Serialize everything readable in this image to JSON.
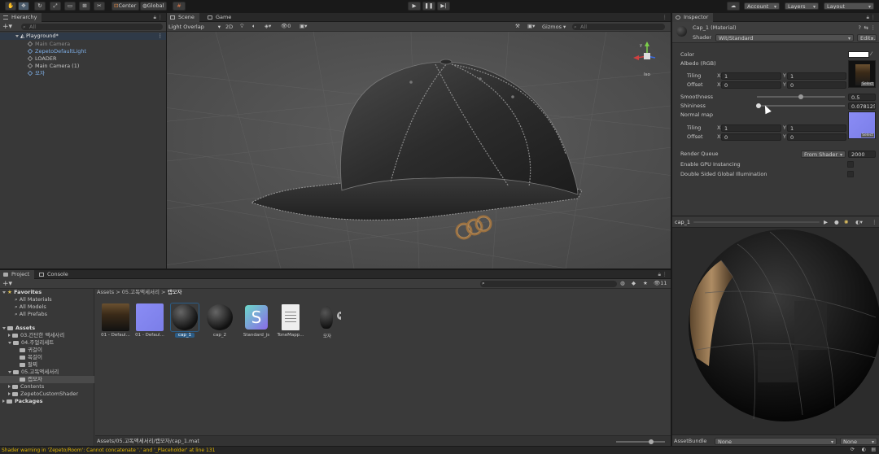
{
  "toolbar": {
    "pivot_label": "Center",
    "space_label": "Global",
    "account_label": "Account",
    "layers_label": "Layers",
    "layout_label": "Layout"
  },
  "hierarchy": {
    "tab_label": "Hierarchy",
    "search_placeholder": "All",
    "scene_name": "Playground*",
    "items": [
      {
        "label": "Main Camera",
        "dim": true
      },
      {
        "label": "ZepetoDefaultLight",
        "blue": true
      },
      {
        "label": "LOADER"
      },
      {
        "label": "Main Camera (1)"
      },
      {
        "label": "모자",
        "blue": true
      }
    ]
  },
  "scene": {
    "tab_scene": "Scene",
    "tab_game": "Game",
    "overlay_label": "Light Overlap",
    "mode_2d": "2D",
    "fx_count": "0",
    "gizmos_label": "Gizmos",
    "search_placeholder": "All",
    "persp_label": "Iso"
  },
  "inspector": {
    "tab_label": "Inspector",
    "material_name": "Cap_1 (Material)",
    "shader_label": "Shader",
    "shader_value": "Wit/Standard",
    "edit_label": "Edit...",
    "color_label": "Color",
    "albedo_label": "Albedo (RGB)",
    "tiling_label": "Tiling",
    "offset_label": "Offset",
    "albedo_tiling": {
      "x": "1",
      "y": "1"
    },
    "albedo_offset": {
      "x": "0",
      "y": "0"
    },
    "smoothness_label": "Smoothness",
    "smoothness_value": "0.5",
    "smoothness_level": 0.5,
    "shininess_label": "Shininess",
    "shininess_value": "0.078125",
    "shininess_level": 0.02,
    "normal_label": "Normal map",
    "normal_tiling": {
      "x": "1",
      "y": "1"
    },
    "normal_offset": {
      "x": "0",
      "y": "0"
    },
    "select_label": "Select",
    "render_queue_label": "Render Queue",
    "render_queue_mode": "From Shader",
    "render_queue_value": "2000",
    "gpu_instancing_label": "Enable GPU Instancing",
    "double_sided_label": "Double Sided Global Illumination",
    "color_value": "#ffffff"
  },
  "preview": {
    "title": "cap_1",
    "assetbundle_label": "AssetBundle",
    "assetbundle_value": "None",
    "variant_value": "None"
  },
  "project": {
    "tab_project": "Project",
    "tab_console": "Console",
    "favorites_label": "Favorites",
    "favorites": [
      "All Materials",
      "All Models",
      "All Prefabs"
    ],
    "assets_label": "Assets",
    "tree": [
      {
        "label": "03.간단한 액세사리",
        "indent": 1,
        "open": false
      },
      {
        "label": "04.주얼리세트",
        "indent": 1,
        "open": true
      },
      {
        "label": "귀걸이",
        "indent": 2
      },
      {
        "label": "목걸이",
        "indent": 2
      },
      {
        "label": "팔찌",
        "indent": 2
      },
      {
        "label": "05.고독액세서리",
        "indent": 1,
        "open": true
      },
      {
        "label": "캡모자",
        "indent": 2,
        "selected": true
      },
      {
        "label": "Contents",
        "indent": 1,
        "open": false
      },
      {
        "label": "ZepetoCustomShader",
        "indent": 1,
        "open": false
      }
    ],
    "packages_label": "Packages",
    "breadcrumb": [
      "Assets",
      "05.고독액세서리",
      "캡모자"
    ],
    "zoom_count": "11",
    "assets": [
      {
        "label": "01 - Defaul...",
        "kind": "texture-albedo"
      },
      {
        "label": "01 - Defaul...",
        "kind": "texture-normal"
      },
      {
        "label": "cap_1",
        "kind": "material",
        "selected": true
      },
      {
        "label": "cap_2",
        "kind": "material"
      },
      {
        "label": "Standard_js",
        "kind": "shader"
      },
      {
        "label": "ToneMapp...",
        "kind": "document"
      },
      {
        "label": "모자",
        "kind": "model"
      }
    ],
    "path": "Assets/05.고독액세서리/캡모자/cap_1.mat"
  },
  "status": {
    "message": "Shader warning in 'Zepeto/Room': Cannot concatenate '.' and '_Placeholder' at line 131"
  },
  "colors": {
    "accent": "#2c5d87",
    "selection": "#2c5d87",
    "warning": "#e0b400",
    "link_blue": "#7fb0e8"
  }
}
